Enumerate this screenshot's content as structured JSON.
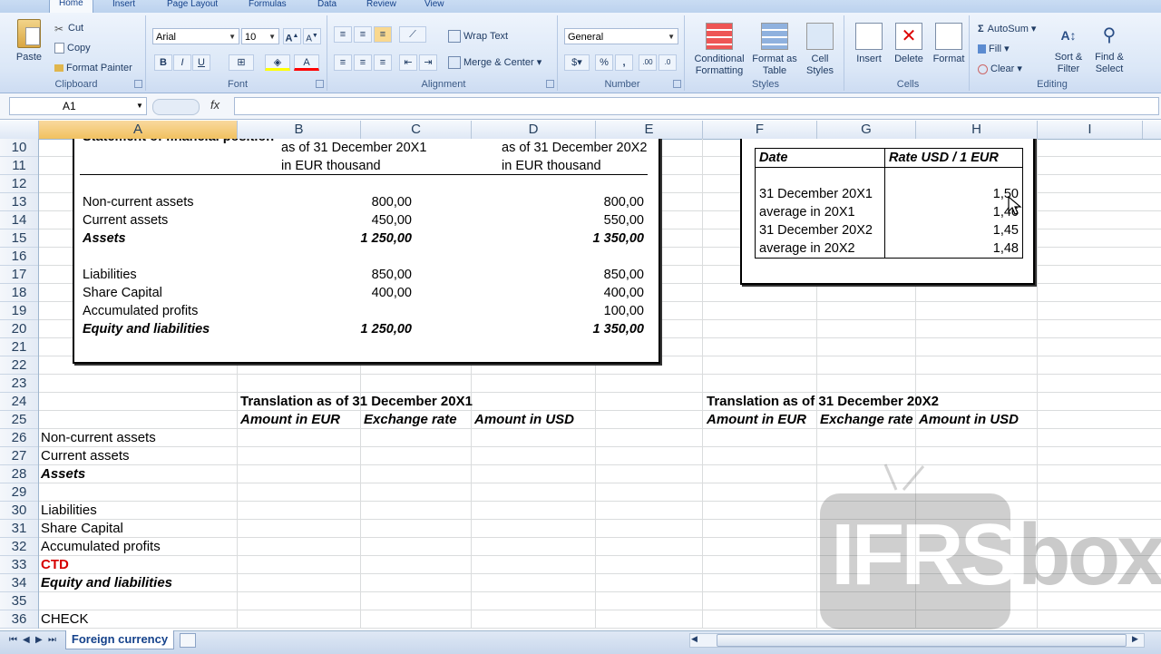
{
  "ribbon": {
    "tabs": [
      "Home",
      "Insert",
      "Page Layout",
      "Formulas",
      "Data",
      "Review",
      "View"
    ],
    "clipboard": {
      "paste": "Paste",
      "cut": "Cut",
      "copy": "Copy",
      "format_painter": "Format Painter",
      "label": "Clipboard"
    },
    "font": {
      "family": "Arial",
      "size": "10",
      "label": "Font"
    },
    "alignment": {
      "wrap_text": "Wrap Text",
      "merge_center": "Merge & Center",
      "label": "Alignment"
    },
    "number": {
      "format": "General",
      "percent": "%",
      "comma": ",",
      "label": "Number"
    },
    "styles": {
      "conditional_formatting": "Conditional Formatting",
      "format_as_table": "Format as Table",
      "cell_styles": "Cell Styles",
      "label": "Styles"
    },
    "cells": {
      "insert": "Insert",
      "delete": "Delete",
      "format": "Format",
      "label": "Cells"
    },
    "editing": {
      "autosum": "AutoSum",
      "fill": "Fill",
      "clear": "Clear",
      "sort_filter": "Sort & Filter",
      "find_select": "Find & Select",
      "label": "Editing"
    }
  },
  "formula_bar": {
    "name_box": "A1",
    "fx": "fx",
    "value": ""
  },
  "columns": [
    "A",
    "B",
    "C",
    "D",
    "E",
    "F",
    "G",
    "H",
    "I"
  ],
  "selected_column": "A",
  "rows": [
    "10",
    "11",
    "12",
    "13",
    "14",
    "15",
    "16",
    "17",
    "18",
    "19",
    "20",
    "21",
    "22",
    "23",
    "24",
    "25",
    "26",
    "27",
    "28",
    "29",
    "30",
    "31",
    "32",
    "33",
    "34",
    "35",
    "36"
  ],
  "fp_box": {
    "title": "Statement of financial position",
    "col1_header": [
      "as of 31 December 20X1",
      "in EUR thousand"
    ],
    "col2_header": [
      "as of 31 December 20X2",
      "in EUR thousand"
    ],
    "lines": [
      {
        "label": "Non-current assets",
        "v1": "800,00",
        "v2": "800,00",
        "style": "normal"
      },
      {
        "label": "Current assets",
        "v1": "450,00",
        "v2": "550,00",
        "style": "normal"
      },
      {
        "label": "Assets",
        "v1": "1 250,00",
        "v2": "1 350,00",
        "style": "bi"
      },
      {
        "label": "",
        "v1": "",
        "v2": "",
        "style": "normal"
      },
      {
        "label": "Liabilities",
        "v1": "850,00",
        "v2": "850,00",
        "style": "normal"
      },
      {
        "label": "Share Capital",
        "v1": "400,00",
        "v2": "400,00",
        "style": "normal"
      },
      {
        "label": "Accumulated profits",
        "v1": "",
        "v2": "100,00",
        "style": "normal"
      },
      {
        "label": "Equity and liabilities",
        "v1": "1 250,00",
        "v2": "1 350,00",
        "style": "bi"
      }
    ]
  },
  "rate_box": {
    "header_date": "Date",
    "header_rate": "Rate USD / 1 EUR",
    "rows": [
      {
        "date": "31 December 20X1",
        "rate": "1,50"
      },
      {
        "date": "average in 20X1",
        "rate": "1,46"
      },
      {
        "date": "31 December 20X2",
        "rate": "1,45"
      },
      {
        "date": "average in 20X2",
        "rate": "1,48"
      }
    ]
  },
  "translation": {
    "x1_title": "Translation as of 31 December 20X1",
    "x2_title": "Translation as of 31 December 20X2",
    "h_amount_eur": "Amount in EUR",
    "h_rate": "Exchange rate",
    "h_amount_usd": "Amount in USD"
  },
  "column_a": [
    {
      "text": "Non-current assets",
      "style": "normal"
    },
    {
      "text": "Current assets",
      "style": "normal"
    },
    {
      "text": "Assets",
      "style": "bi"
    },
    {
      "text": "",
      "style": "normal"
    },
    {
      "text": "Liabilities",
      "style": "normal"
    },
    {
      "text": "Share Capital",
      "style": "normal"
    },
    {
      "text": "Accumulated profits",
      "style": "normal"
    },
    {
      "text": "CTD",
      "style": "red"
    },
    {
      "text": "Equity and liabilities",
      "style": "bi"
    },
    {
      "text": "",
      "style": "normal"
    },
    {
      "text": "CHECK",
      "style": "normal"
    }
  ],
  "sheet_tab": "Foreign currency",
  "watermark": {
    "left": "IFRS",
    "right": "box"
  },
  "colors": {
    "ribbon": "#dbe7f7",
    "selected_header": "#f1c15f",
    "ctd_red": "#d60000"
  }
}
